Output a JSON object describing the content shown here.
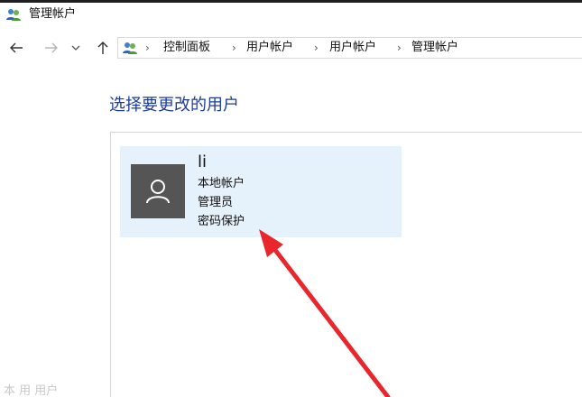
{
  "window": {
    "title": "管理帐户",
    "title_icon": "user-accounts-icon"
  },
  "nav": {
    "back_icon": "back-arrow-icon",
    "forward_icon": "forward-arrow-icon",
    "recent_icon": "chevron-down-icon",
    "up_icon": "up-arrow-icon"
  },
  "address": {
    "icon": "user-accounts-icon",
    "breadcrumbs": [
      "控制面板",
      "用户帐户",
      "用户帐户",
      "管理帐户"
    ],
    "separator": "›"
  },
  "main": {
    "heading": "选择要更改的用户"
  },
  "user": {
    "name": "li",
    "type": "本地帐户",
    "role": "管理员",
    "protection": "密码保护",
    "avatar_icon": "user-silhouette-icon"
  },
  "annotation": {
    "arrow_color": "#e8262b",
    "icon": "red-arrow-annotation"
  },
  "footer_ghost": {
    "text": "本 用 用户"
  },
  "colors": {
    "heading": "#1e3d9a",
    "card_bg": "#e5f1fb",
    "avatar_bg": "#555555"
  }
}
